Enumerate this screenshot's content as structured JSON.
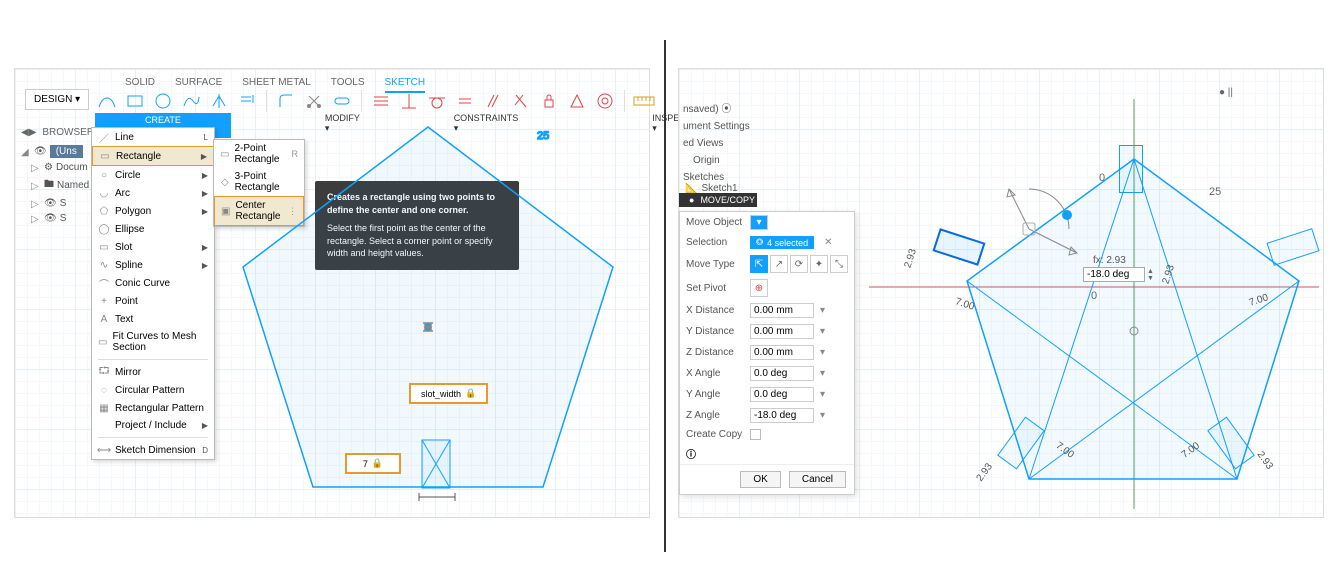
{
  "left": {
    "tabs": [
      "SOLID",
      "SURFACE",
      "SHEET METAL",
      "TOOLS",
      "SKETCH"
    ],
    "active_tab": "SKETCH",
    "design_btn": "DESIGN ▾",
    "toolbar_groups": {
      "create": "CREATE ▾",
      "modify": "MODIFY ▾",
      "constraints": "CONSTRAINTS ▾",
      "inspect": "INSPECT ▾"
    },
    "create_menu": [
      {
        "icon": "line",
        "label": "Line",
        "short": "L"
      },
      {
        "icon": "rect",
        "label": "Rectangle",
        "short": "",
        "sub": true,
        "hi": true
      },
      {
        "icon": "circle",
        "label": "Circle",
        "sub": true
      },
      {
        "icon": "arc",
        "label": "Arc",
        "sub": true
      },
      {
        "icon": "polygon",
        "label": "Polygon",
        "sub": true
      },
      {
        "icon": "ellipse",
        "label": "Ellipse"
      },
      {
        "icon": "slot",
        "label": "Slot",
        "sub": true
      },
      {
        "icon": "spline",
        "label": "Spline",
        "sub": true
      },
      {
        "icon": "conic",
        "label": "Conic Curve"
      },
      {
        "icon": "point",
        "label": "Point"
      },
      {
        "icon": "text",
        "label": "Text"
      },
      {
        "icon": "fit",
        "label": "Fit Curves to Mesh Section"
      },
      {
        "sep": true
      },
      {
        "icon": "mirror",
        "label": "Mirror"
      },
      {
        "icon": "cpat",
        "label": "Circular Pattern"
      },
      {
        "icon": "rpat",
        "label": "Rectangular Pattern"
      },
      {
        "icon": "proj",
        "label": "Project / Include",
        "sub": true
      },
      {
        "sep": true
      },
      {
        "icon": "dim",
        "label": "Sketch Dimension",
        "short": "D"
      }
    ],
    "sub_menu": [
      {
        "label": "2-Point Rectangle",
        "short": "R"
      },
      {
        "label": "3-Point Rectangle"
      },
      {
        "label": "Center Rectangle",
        "hi": true
      }
    ],
    "tooltip": {
      "title": "Creates a rectangle using two points to define the center and one corner.",
      "body": "Select the first point as the center of the rectangle. Select a corner point or specify width and height values."
    },
    "browser": {
      "header": "BROWSER",
      "rows": [
        "(Uns",
        "Docum",
        "Named",
        "S",
        "S"
      ]
    },
    "dim_label": "slot_width",
    "dim_value": "7",
    "axis_num": "25"
  },
  "right": {
    "top_dot": "●  ||",
    "side": {
      "unsaved": "nsaved)  ⦿",
      "l1": "ument Settings",
      "l2": "ed Views",
      "l3": "Origin",
      "l4": "Sketches",
      "crumb": "Sketch1"
    },
    "mv": {
      "header": "MOVE/COPY",
      "rows": {
        "move_object": "Move Object",
        "selection": "Selection",
        "selection_count": "4 selected",
        "move_type": "Move Type",
        "set_pivot": "Set Pivot",
        "x_dist_l": "X Distance",
        "x_dist": "0.00 mm",
        "y_dist_l": "Y Distance",
        "y_dist": "0.00 mm",
        "z_dist_l": "Z Distance",
        "z_dist": "0.00 mm",
        "x_ang_l": "X Angle",
        "x_ang": "0.0 deg",
        "y_ang_l": "Y Angle",
        "y_ang": "0.0 deg",
        "z_ang_l": "Z Angle",
        "z_ang": "-18.0 deg",
        "create_copy": "Create Copy"
      },
      "ok": "OK",
      "cancel": "Cancel"
    },
    "canvas": {
      "angle_input": "-18.0 deg",
      "dim_long": "7.00",
      "dim_short": "2.93",
      "zero": "0",
      "axis25": "25"
    }
  }
}
